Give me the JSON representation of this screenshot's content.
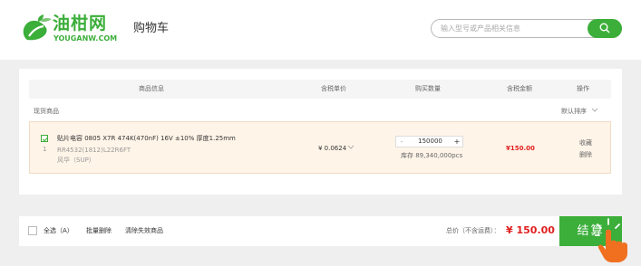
{
  "header": {
    "logo_cn": "油柑网",
    "logo_en": "YOUGANW.COM",
    "page_title": "购物车",
    "search_placeholder": "输入型号或产品相关信息",
    "search_icon": "search-icon"
  },
  "table": {
    "headers": [
      "商品信息",
      "含税单价",
      "购买数量",
      "含税金额",
      "操作"
    ],
    "group_label": "现货商品",
    "sort_label": "默认排序"
  },
  "item": {
    "checked": true,
    "index": "1",
    "name": "贴片电容 0805 X7R 474K(470nF) 16V ±10% 厚度1.25mm",
    "code": "RR4532(1812)L22R6FT",
    "brand": "风华（SUP）",
    "unit_price": "¥ 0.0624",
    "quantity": "150000",
    "minus": "-",
    "plus": "+",
    "stock": "库存 89,340,000pcs",
    "amount": "¥150.00",
    "actions": [
      "收藏",
      "删除"
    ]
  },
  "footer": {
    "select_all": "全选（A）",
    "batch_delete": "批量删除",
    "clear_invalid": "清除失效商品",
    "total_label": "总价（不含运费）：",
    "total_value": "¥ 150.00",
    "checkout": "结算"
  },
  "colors": {
    "brand": "#3cae3a",
    "price": "#e02020",
    "item_bg": "#fff4e8",
    "cursor": "#f07020"
  }
}
